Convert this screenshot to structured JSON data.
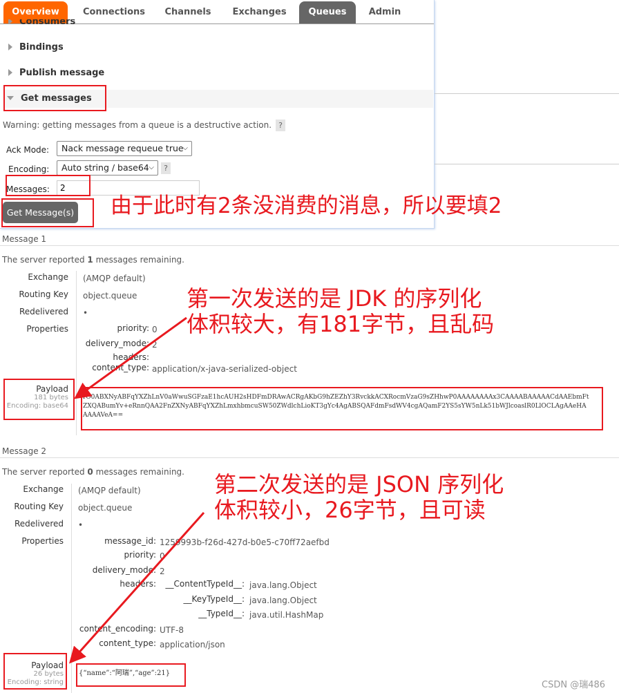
{
  "nav": {
    "tabs": [
      {
        "label": "Overview",
        "active": true
      },
      {
        "label": "Connections"
      },
      {
        "label": "Channels"
      },
      {
        "label": "Exchanges"
      },
      {
        "label": "Queues",
        "selected": true
      },
      {
        "label": "Admin"
      }
    ],
    "accent": "#ff6600",
    "selected_bg": "#666666"
  },
  "sections": {
    "consumers": "Consumers",
    "bindings": "Bindings",
    "publish": "Publish message",
    "get": "Get messages"
  },
  "form": {
    "warning": "Warning: getting messages from a queue is a destructive action.",
    "help": "?",
    "ack_label": "Ack Mode:",
    "ack_value": "Nack message requeue true",
    "enc_label": "Encoding:",
    "enc_value": "Auto string / base64",
    "msg_label": "Messages:",
    "msg_value": "2",
    "button": "Get Message(s)"
  },
  "messages": [
    {
      "title": "Message 1",
      "remaining_pre": "The server reported ",
      "remaining_count": "1",
      "remaining_post": " messages remaining.",
      "exchange_label": "Exchange",
      "exchange": "(AMQP default)",
      "rk_label": "Routing Key",
      "rk": "object.queue",
      "redelivered_label": "Redelivered",
      "redelivered": "•",
      "props_label": "Properties",
      "props": [
        {
          "k": "priority:",
          "v": "0"
        },
        {
          "k": "delivery_mode:",
          "v": "2"
        },
        {
          "k": "headers:",
          "v": ""
        },
        {
          "k": "content_type:",
          "v": "application/x-java-serialized-object"
        }
      ],
      "payload_label": "Payload",
      "bytes": "181 bytes",
      "encoding": "Encoding: base64",
      "payload": "rO0ABXNyABFqYXZhLnV0aWwuSGFzaE1hcAUH2sHDFmDRAwACRgAKbG9hZEZhY3RvckkACXRocmVzaG9sZHhwP0AAAAAAAAx3CAAAABAAAAACdAAEbmFtZXQABumYv+eRnnQAA2FnZXNyABFqYXZhLmxhbmcuSW50ZWdlchLioKT3gYc4AgABSQAFdmFsdWV4cgAQamF2YS5sYW5nLk51bWJlcoaslR0LlOCLAgAAeHAAAAAVeA=="
    },
    {
      "title": "Message 2",
      "remaining_pre": "The server reported ",
      "remaining_count": "0",
      "remaining_post": " messages remaining.",
      "exchange_label": "Exchange",
      "exchange": "(AMQP default)",
      "rk_label": "Routing Key",
      "rk": "object.queue",
      "redelivered_label": "Redelivered",
      "redelivered": "•",
      "props_label": "Properties",
      "props": [
        {
          "k": "message_id:",
          "v": "1259993b-f26d-427d-b0e5-c70ff72aefbd"
        },
        {
          "k": "priority:",
          "v": "0"
        },
        {
          "k": "delivery_mode:",
          "v": "2"
        },
        {
          "k": "headers:",
          "v": ""
        },
        {
          "k": "content_encoding:",
          "v": "UTF-8"
        },
        {
          "k": "content_type:",
          "v": "application/json"
        }
      ],
      "headers": [
        {
          "k": "__ContentTypeId__:",
          "v": "java.lang.Object"
        },
        {
          "k": "__KeyTypeId__:",
          "v": "java.lang.Object"
        },
        {
          "k": "__TypeId__:",
          "v": "java.util.HashMap"
        }
      ],
      "payload_label": "Payload",
      "bytes": "26 bytes",
      "encoding": "Encoding: string",
      "payload": "{“name”:“阿瑞”,“age”:21}"
    }
  ],
  "annotations": {
    "a1": "由于此时有2条没消费的消息，所以要填2",
    "a2_l1": "第一次发送的是 JDK 的序列化",
    "a2_l2": "体积较大，有181字节，且乱码",
    "a3_l1": "第二次发送的是 JSON 序列化",
    "a3_l2": "体积较小，26字节，且可读",
    "color": "#e8191f"
  },
  "watermark": "CSDN @瑞486"
}
